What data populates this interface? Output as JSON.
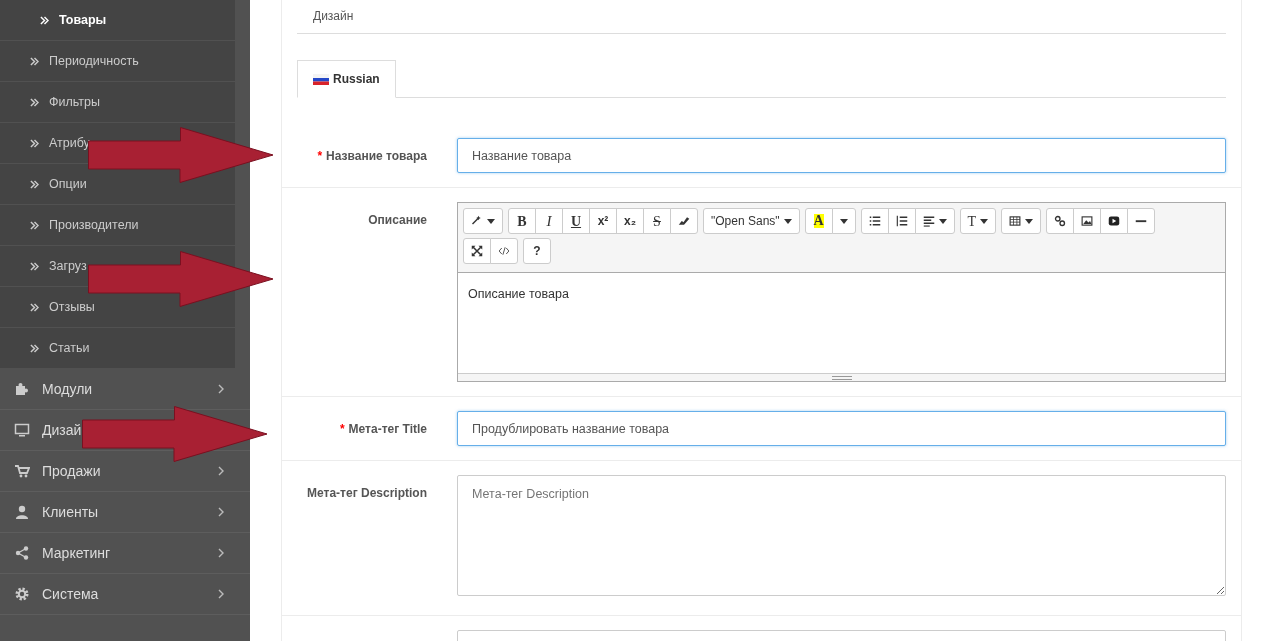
{
  "sidebar": {
    "sub_items": [
      {
        "label": "Товары",
        "selected": true
      },
      {
        "label": "Периодичность",
        "selected": false
      },
      {
        "label": "Фильтры",
        "selected": false
      },
      {
        "label": "Атрибу",
        "selected": false
      },
      {
        "label": "Опции",
        "selected": false
      },
      {
        "label": "Производители",
        "selected": false
      },
      {
        "label": "Загруз",
        "selected": false
      },
      {
        "label": "Отзывы",
        "selected": false
      },
      {
        "label": "Статьи",
        "selected": false
      }
    ],
    "items": [
      {
        "label": "Модули",
        "kind": "puzzle",
        "chevron": true
      },
      {
        "label": "Дизай",
        "kind": "monitor"
      },
      {
        "label": "Продажи",
        "kind": "cart",
        "chevron": true
      },
      {
        "label": "Клиенты",
        "kind": "user",
        "chevron": true
      },
      {
        "label": "Маркетинг",
        "kind": "share",
        "chevron": true
      },
      {
        "label": "Система",
        "kind": "gear",
        "chevron": true
      }
    ]
  },
  "top_tab": "Дизайн",
  "language_tabs": [
    {
      "label": "Russian",
      "selected": true
    }
  ],
  "form": {
    "name": {
      "marker": "*",
      "label": "Название товара",
      "value": "Название товара"
    },
    "description": {
      "label": "Описание",
      "value": "Описание товара",
      "toolbar": [
        [
          [
            {
              "kind": "magic",
              "caret": true
            }
          ],
          [
            {
              "kind": "bold",
              "label": "B"
            },
            {
              "kind": "italic",
              "label": "I"
            },
            {
              "kind": "underline",
              "label": "U"
            },
            {
              "kind": "superscript",
              "label": "x²"
            },
            {
              "kind": "subscript",
              "label": "x₂"
            },
            {
              "kind": "strike",
              "label": "S"
            },
            {
              "kind": "eraser"
            }
          ],
          [
            {
              "kind": "font",
              "label": "\"Open Sans\"",
              "caret": true
            }
          ],
          [
            {
              "kind": "highlight",
              "label": "A"
            },
            {
              "kind": "caret"
            }
          ],
          [
            {
              "kind": "ul"
            },
            {
              "kind": "ol"
            },
            {
              "kind": "align",
              "caret": true
            }
          ],
          [
            {
              "kind": "fontsize",
              "label": "T",
              "caret": true
            }
          ],
          [
            {
              "kind": "table",
              "caret": true
            }
          ],
          [
            {
              "kind": "link"
            },
            {
              "kind": "image"
            },
            {
              "kind": "video"
            },
            {
              "kind": "hr"
            }
          ]
        ],
        [
          [
            {
              "kind": "expand"
            },
            {
              "kind": "code"
            }
          ],
          [
            {
              "kind": "help",
              "label": "?"
            }
          ]
        ]
      ]
    },
    "meta_title": {
      "marker": "*",
      "label": "Мета-тег Title",
      "value": "Продублировать название товара"
    },
    "meta_description": {
      "label": "Мета-тег Description",
      "placeholder": "Мета-тег Description"
    }
  }
}
